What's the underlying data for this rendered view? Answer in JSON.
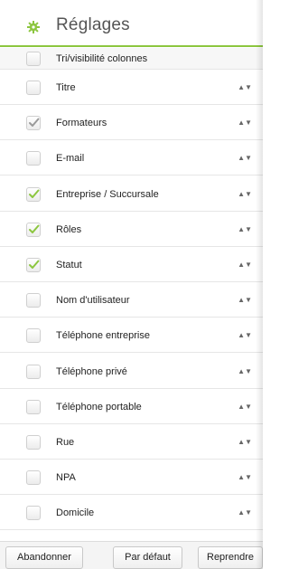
{
  "header": {
    "title": "Réglages",
    "accent_color": "#8cc63f",
    "icon": "gear-icon"
  },
  "sort_toggle": {
    "label": "Tri/visibilité colonnes",
    "checked": false
  },
  "columns": [
    {
      "label": "Titre",
      "checked": false,
      "check_style": "none"
    },
    {
      "label": "Formateurs",
      "checked": true,
      "check_style": "grey"
    },
    {
      "label": "E-mail",
      "checked": false,
      "check_style": "none"
    },
    {
      "label": "Entreprise / Succursale",
      "checked": true,
      "check_style": "green"
    },
    {
      "label": "Rôles",
      "checked": true,
      "check_style": "green"
    },
    {
      "label": "Statut",
      "checked": true,
      "check_style": "green"
    },
    {
      "label": "Nom d'utilisateur",
      "checked": false,
      "check_style": "none"
    },
    {
      "label": "Téléphone entreprise",
      "checked": false,
      "check_style": "none"
    },
    {
      "label": "Téléphone privé",
      "checked": false,
      "check_style": "none"
    },
    {
      "label": "Téléphone portable",
      "checked": false,
      "check_style": "none"
    },
    {
      "label": "Rue",
      "checked": false,
      "check_style": "none"
    },
    {
      "label": "NPA",
      "checked": false,
      "check_style": "none"
    },
    {
      "label": "Domicile",
      "checked": false,
      "check_style": "none"
    }
  ],
  "sort_arrows": "▲▼",
  "footer": {
    "cancel_label": "Abandonner",
    "default_label": "Par défaut",
    "apply_label": "Reprendre"
  }
}
